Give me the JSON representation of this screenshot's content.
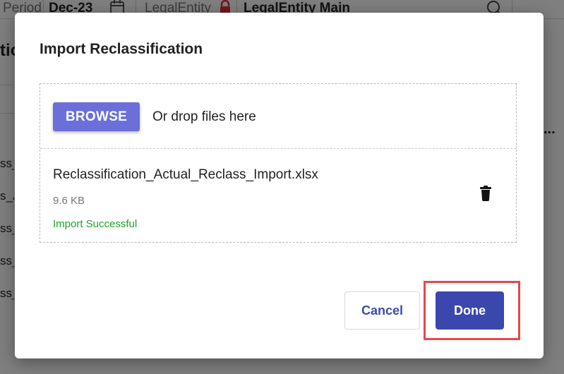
{
  "background": {
    "period_label": "Period",
    "period_value": "Dec-23",
    "legal_entity_label": "LegalEntity",
    "legal_entity_value": "LegalEntity Main",
    "partial_heading": "tio",
    "more_glyph": "...",
    "row_fragments": [
      "ss_",
      "s_A",
      "ss_",
      "ss_",
      "ss_"
    ]
  },
  "dialog": {
    "title": "Import Reclassification",
    "browse_label": "BROWSE",
    "drop_hint": "Or drop files here",
    "file": {
      "name": "Reclassification_Actual_Reclass_Import.xlsx",
      "size": "9.6 KB",
      "status": "Import Successful"
    },
    "cancel_label": "Cancel",
    "done_label": "Done"
  },
  "colors": {
    "browse": "#6c6fd9",
    "primary": "#3a48ad",
    "success": "#1fa12a",
    "highlight": "#e5484d"
  },
  "icons": [
    "calendar-icon",
    "lock-icon",
    "search-icon",
    "trash-icon"
  ]
}
